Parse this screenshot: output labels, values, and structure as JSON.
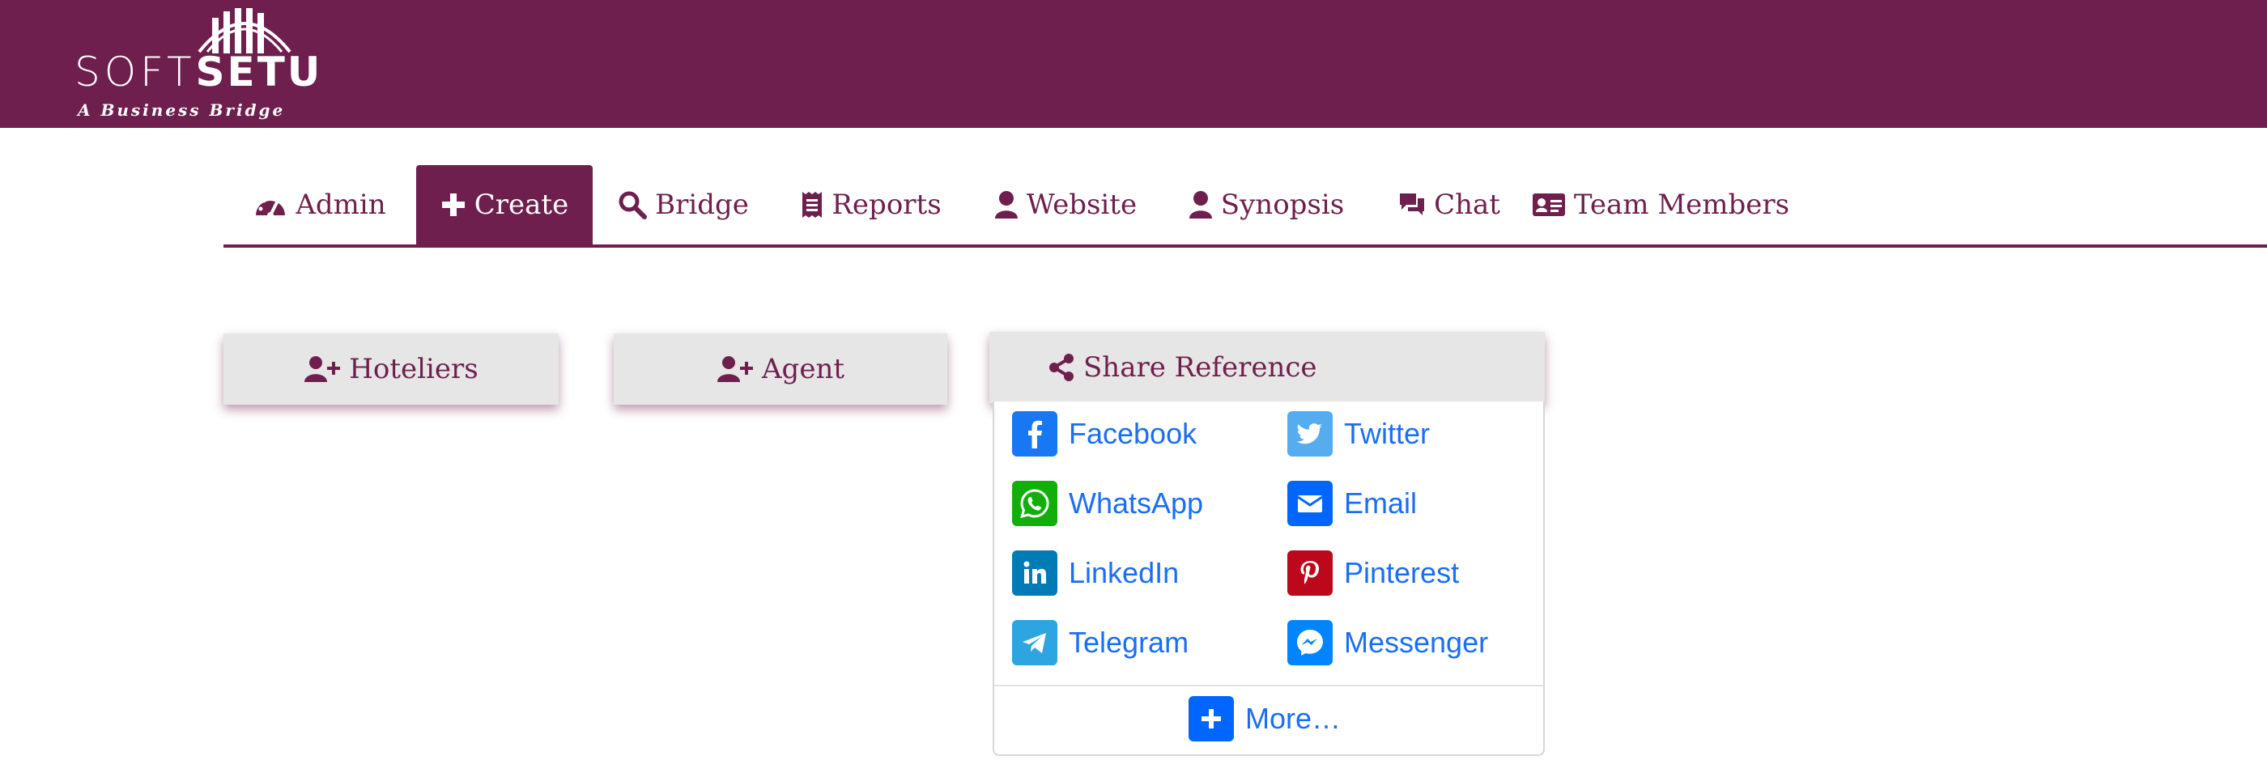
{
  "brand": {
    "word_soft": "SOFT",
    "word_setu": "SETU",
    "tagline": "A Business Bridge"
  },
  "nav": {
    "tabs": [
      {
        "label": "Admin",
        "icon": "dashboard-gauge-icon",
        "active": false
      },
      {
        "label": "Create",
        "icon": "plus-icon",
        "active": true
      },
      {
        "label": "Bridge",
        "icon": "search-icon",
        "active": false
      },
      {
        "label": "Reports",
        "icon": "receipt-icon",
        "active": false
      },
      {
        "label": "Website",
        "icon": "user-icon",
        "active": false
      },
      {
        "label": "Synopsis",
        "icon": "user-icon",
        "active": false
      },
      {
        "label": "Chat",
        "icon": "comments-icon",
        "active": false
      },
      {
        "label": "Team Members",
        "icon": "id-card-icon",
        "active": false
      }
    ]
  },
  "actions": {
    "hoteliers": {
      "label": "Hoteliers",
      "icon": "user-plus-icon"
    },
    "agent": {
      "label": "Agent",
      "icon": "user-plus-icon"
    },
    "share": {
      "label": "Share Reference",
      "icon": "share-nodes-icon"
    }
  },
  "share_menu": {
    "items": [
      {
        "label": "Facebook",
        "icon": "facebook-icon",
        "color": "#1877f2"
      },
      {
        "label": "Twitter",
        "icon": "twitter-icon",
        "color": "#55acee"
      },
      {
        "label": "WhatsApp",
        "icon": "whatsapp-icon",
        "color": "#12af0a"
      },
      {
        "label": "Email",
        "icon": "email-icon",
        "color": "#0166ff"
      },
      {
        "label": "LinkedIn",
        "icon": "linkedin-icon",
        "color": "#007bb5"
      },
      {
        "label": "Pinterest",
        "icon": "pinterest-icon",
        "color": "#bd081c"
      },
      {
        "label": "Telegram",
        "icon": "telegram-icon",
        "color": "#2ca5e0"
      },
      {
        "label": "Messenger",
        "icon": "messenger-icon",
        "color": "#0084ff"
      }
    ],
    "more_label": "More…",
    "more_color": "#0166ff"
  },
  "colors": {
    "brand": "#6e1f4d",
    "button_bg": "#e6e6e6",
    "link": "#1a6ef5"
  }
}
